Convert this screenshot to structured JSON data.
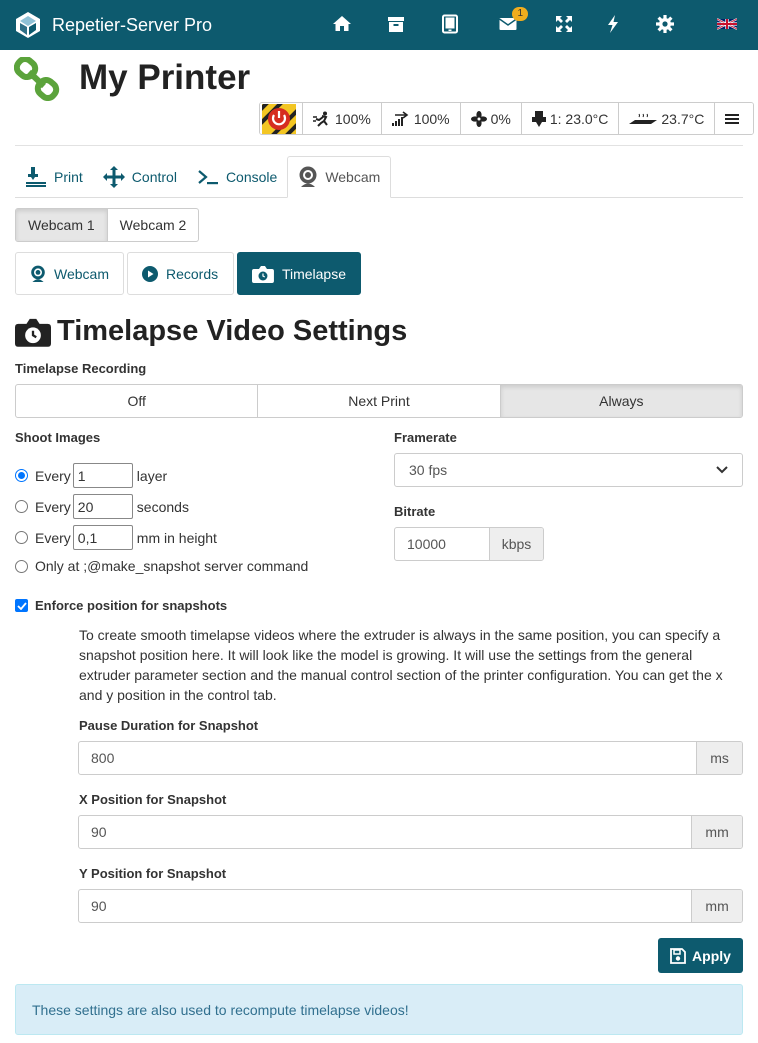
{
  "app": {
    "title": "Repetier-Server Pro",
    "message_count": "1",
    "nav_icons": [
      "home-icon",
      "archive-icon",
      "tablet-icon",
      "envelope-icon",
      "expand-icon",
      "bolt-icon",
      "gear-icon",
      "flag-uk-icon"
    ]
  },
  "printer": {
    "name": "My Printer",
    "status": {
      "speed": "100%",
      "flow": "100%",
      "fan": "0%",
      "extruder": "1: 23.0°C",
      "bed": "23.7°C"
    }
  },
  "main_tabs": [
    {
      "label": "Print",
      "icon": "print-icon"
    },
    {
      "label": "Control",
      "icon": "move-arrows-icon"
    },
    {
      "label": "Console",
      "icon": "terminal-icon"
    },
    {
      "label": "Webcam",
      "icon": "webcam-icon",
      "active": true
    }
  ],
  "webcams": [
    {
      "label": "Webcam 1",
      "active": true
    },
    {
      "label": "Webcam 2"
    }
  ],
  "sub_tabs": [
    {
      "label": "Webcam",
      "icon": "webcam-icon"
    },
    {
      "label": "Records",
      "icon": "play-circle-icon"
    },
    {
      "label": "Timelapse",
      "icon": "camera-icon",
      "active": true
    }
  ],
  "timelapse": {
    "title": "Timelapse Video Settings",
    "recording_label": "Timelapse Recording",
    "recording_options": [
      {
        "label": "Off"
      },
      {
        "label": "Next Print"
      },
      {
        "label": "Always",
        "active": true
      }
    ],
    "shoot_label": "Shoot Images",
    "shoot_options": {
      "every_prefix": "Every",
      "layer": {
        "value": "1",
        "unit": "layer",
        "selected": true
      },
      "seconds": {
        "value": "20",
        "unit": "seconds"
      },
      "height": {
        "value": "0,1",
        "unit": "mm in height"
      },
      "command_label": "Only at ;@make_snapshot server command"
    },
    "framerate_label": "Framerate",
    "framerate_value": "30 fps",
    "bitrate_label": "Bitrate",
    "bitrate_value": "10000",
    "bitrate_unit": "kbps",
    "enforce_label": "Enforce position for snapshots",
    "enforce_checked": true,
    "enforce_description": "To create smooth timelapse videos where the extruder is always in the same position, you can specify a snapshot position here. It will look like the model is growing. It will use the settings from the general extruder parameter section and the manual control section of the printer configuration. You can get the x and y position in the control tab.",
    "pause_label": "Pause Duration for Snapshot",
    "pause_value": "800",
    "pause_unit": "ms",
    "x_label": "X Position for Snapshot",
    "x_value": "90",
    "x_unit": "mm",
    "y_label": "Y Position for Snapshot",
    "y_value": "90",
    "y_unit": "mm",
    "apply_label": "Apply",
    "info_text": "These settings are also used to recompute timelapse videos!"
  },
  "colors": {
    "primary": "#0d5a6e",
    "logo_green": "#5ba33b",
    "info_bg": "#d9edf7",
    "badge": "#f0ad1e"
  }
}
